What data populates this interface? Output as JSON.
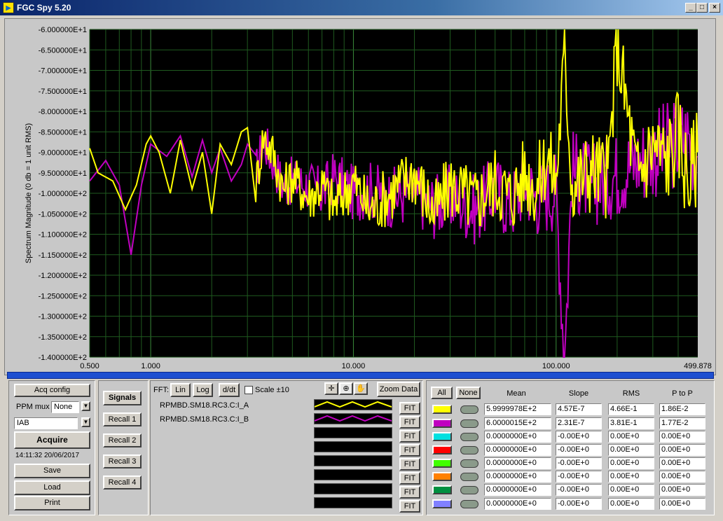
{
  "window": {
    "title": "FGC Spy 5.20",
    "min_label": "_",
    "max_label": "□",
    "close_label": "×"
  },
  "chart_data": {
    "type": "line",
    "ylabel": "Spectrum Magnitude (0 db = 1 unit RMS)",
    "xlabel": "",
    "x_scale": "log",
    "xlim": [
      0.5,
      499.878
    ],
    "ylim": [
      -140,
      -60
    ],
    "grid": true,
    "y_ticks": [
      "-6.000000E+1",
      "-6.500000E+1",
      "-7.000000E+1",
      "-7.500000E+1",
      "-8.000000E+1",
      "-8.500000E+1",
      "-9.000000E+1",
      "-9.500000E+1",
      "-1.000000E+2",
      "-1.050000E+2",
      "-1.100000E+2",
      "-1.150000E+2",
      "-1.200000E+2",
      "-1.250000E+2",
      "-1.300000E+2",
      "-1.350000E+2",
      "-1.400000E+2"
    ],
    "x_ticks": [
      "0.500",
      "1.000",
      "10.000",
      "100.000",
      "499.878"
    ],
    "series": [
      {
        "name": "RPMBD.SM18.RC3.C:I_B",
        "color": "#c000c0",
        "x": [
          0.5,
          0.6,
          0.7,
          0.8,
          0.9,
          1.0,
          1.2,
          1.4,
          1.6,
          1.8,
          2.0,
          2.2,
          2.5,
          2.8,
          3.0,
          3.3,
          3.6,
          4.0,
          4.5,
          5,
          6,
          7,
          8,
          10,
          12,
          15,
          20,
          25,
          30,
          40,
          50,
          60,
          70,
          80,
          100,
          110,
          120,
          150,
          200,
          250,
          300,
          350,
          400,
          450,
          499
        ],
        "y": [
          -97,
          -92,
          -98,
          -115,
          -98,
          -88,
          -91,
          -86,
          -96,
          -87,
          -95,
          -89,
          -97,
          -93,
          -88,
          -95,
          -87,
          -92,
          -98,
          -97,
          -98,
          -100,
          -96,
          -100,
          -99,
          -101,
          -100,
          -103,
          -101,
          -104,
          -99,
          -103,
          -97,
          -101,
          -99,
          -141,
          -94,
          -98,
          -95,
          -92,
          -90,
          -89,
          -87,
          -86,
          -91
        ]
      },
      {
        "name": "RPMBD.SM18.RC3.C:I_A",
        "color": "#ffff00",
        "x": [
          0.5,
          0.55,
          0.65,
          0.75,
          0.85,
          0.95,
          1.0,
          1.1,
          1.25,
          1.4,
          1.6,
          1.8,
          2.0,
          2.2,
          2.5,
          2.8,
          3.0,
          3.3,
          3.6,
          4.0,
          4.5,
          5,
          6,
          7,
          8,
          10,
          12,
          15,
          20,
          25,
          30,
          40,
          50,
          60,
          70,
          80,
          90,
          100,
          110,
          120,
          150,
          180,
          200,
          250,
          300,
          350,
          400,
          450,
          499
        ],
        "y": [
          -89,
          -95,
          -97,
          -104,
          -98,
          -88,
          -86,
          -90,
          -100,
          -87,
          -99,
          -90,
          -105,
          -88,
          -93,
          -85,
          -84,
          -98,
          -86,
          -90,
          -99,
          -96,
          -101,
          -98,
          -103,
          -97,
          -104,
          -100,
          -95,
          -105,
          -98,
          -102,
          -97,
          -101,
          -95,
          -99,
          -91,
          -97,
          -66,
          -98,
          -94,
          -96,
          -63,
          -96,
          -88,
          -92,
          -85,
          -97,
          -90
        ]
      }
    ]
  },
  "controls": {
    "acq_config": "Acq config",
    "ppm_mux_label": "PPM mux",
    "ppm_mux_value": "None",
    "signal_value": "IAB",
    "acquire": "Acquire",
    "timestamp": "14:11:32 20/06/2017",
    "save": "Save",
    "load": "Load",
    "print": "Print"
  },
  "recall": {
    "signals": "Signals",
    "recall1": "Recall 1",
    "recall2": "Recall 2",
    "recall3": "Recall 3",
    "recall4": "Recall 4"
  },
  "fft": {
    "label": "FFT:",
    "lin": "Lin",
    "log": "Log",
    "ddt": "d/dt",
    "scale": "Scale ±10",
    "zoom_data": "Zoom Data",
    "fit": "FIT"
  },
  "signals": [
    "RPMBD.SM18.RC3.C:I_A",
    "RPMBD.SM18.RC3.C:I_B",
    "",
    "",
    "",
    "",
    "",
    ""
  ],
  "stats": {
    "all": "All",
    "none": "None",
    "headers": {
      "mean": "Mean",
      "slope": "Slope",
      "rms": "RMS",
      "ptop": "P to P"
    },
    "colors": [
      "#ffff00",
      "#c000c0",
      "#00e0e0",
      "#ff0000",
      "#40ff00",
      "#ff8000",
      "#009040",
      "#8080ff"
    ],
    "rows": [
      {
        "mean": "5.9999978E+2",
        "slope": "4.57E-7",
        "rms": "4.66E-1",
        "ptop": "1.86E-2"
      },
      {
        "mean": "6.0000015E+2",
        "slope": "2.31E-7",
        "rms": "3.81E-1",
        "ptop": "1.77E-2"
      },
      {
        "mean": "0.0000000E+0",
        "slope": "-0.00E+0",
        "rms": "0.00E+0",
        "ptop": "0.00E+0"
      },
      {
        "mean": "0.0000000E+0",
        "slope": "-0.00E+0",
        "rms": "0.00E+0",
        "ptop": "0.00E+0"
      },
      {
        "mean": "0.0000000E+0",
        "slope": "-0.00E+0",
        "rms": "0.00E+0",
        "ptop": "0.00E+0"
      },
      {
        "mean": "0.0000000E+0",
        "slope": "-0.00E+0",
        "rms": "0.00E+0",
        "ptop": "0.00E+0"
      },
      {
        "mean": "0.0000000E+0",
        "slope": "-0.00E+0",
        "rms": "0.00E+0",
        "ptop": "0.00E+0"
      },
      {
        "mean": "0.0000000E+0",
        "slope": "-0.00E+0",
        "rms": "0.00E+0",
        "ptop": "0.00E+0"
      }
    ]
  }
}
